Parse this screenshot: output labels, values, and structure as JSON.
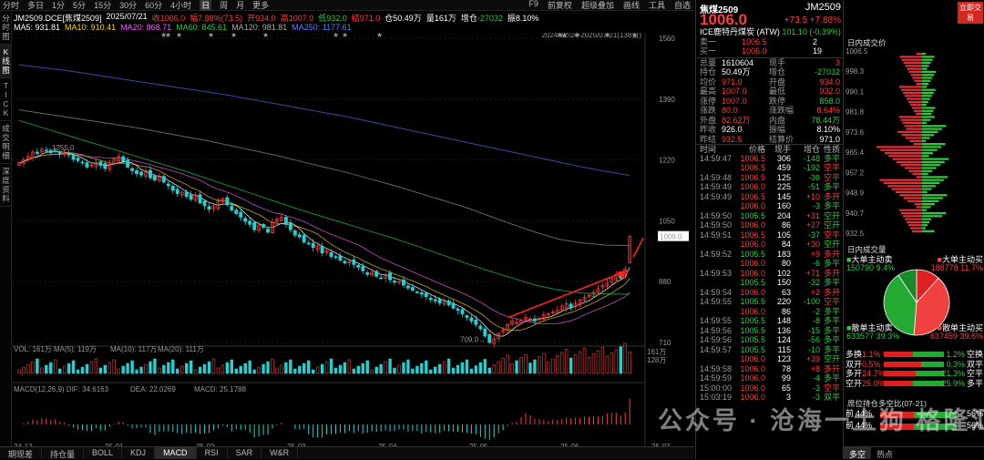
{
  "topbar": {
    "items": [
      "分时",
      "多日",
      "1分",
      "5分",
      "15分",
      "30分",
      "60分",
      "4小时",
      "日",
      "周",
      "月",
      "更多"
    ],
    "selected": "日",
    "right": [
      "F9",
      "前复权",
      "超级叠加",
      "画线",
      "工具",
      "自选"
    ]
  },
  "leftrail": [
    "分时图",
    "K线图",
    "TICK",
    "成交明细",
    "深度资料"
  ],
  "info": {
    "symbol": "JM2509.DCE[焦煤2509]",
    "date": "2025/07/21",
    "close": "收1006.0",
    "change": "幅7.88%(73.5)",
    "open": "开934.0",
    "high": "高1007.0",
    "low": "低932.0",
    "settle": "结971.0",
    "oi": "仓50.49万",
    "vol": "量161万",
    "ci": "-27032",
    "amp": "振8.10%"
  },
  "ma": [
    {
      "label": "MA5",
      "value": "931.81",
      "color": "#ffffff"
    },
    {
      "label": "MA10",
      "value": "910.41",
      "color": "#ffd700"
    },
    {
      "label": "MA20",
      "value": "868.71",
      "color": "#ff55ff"
    },
    {
      "label": "MA60",
      "value": "845.61",
      "color": "#2ecc40"
    },
    {
      "label": "MA120",
      "value": "981.81",
      "color": "#aaaaaa"
    },
    {
      "label": "MA250",
      "value": "1177.61",
      "color": "#5f7fff"
    }
  ],
  "chart_data": {
    "type": "candlestick",
    "date_range": "2024/12/24-2025/07/21(138日)",
    "y_ticks": [
      "1560",
      "1390",
      "1220",
      "1050",
      "880",
      "710"
    ],
    "x_ticks": [
      "24-12",
      "25-01",
      "25-02",
      "25-03",
      "25-04",
      "25-05",
      "25-06",
      "25-07"
    ],
    "annotations": {
      "high": "1255.0",
      "low": "709.0",
      "last": "1006.0"
    },
    "closes": [
      1212,
      1220,
      1230,
      1242,
      1238,
      1250,
      1246,
      1240,
      1244,
      1236,
      1242,
      1234,
      1222,
      1218,
      1212,
      1200,
      1206,
      1214,
      1205,
      1196,
      1208,
      1222,
      1230,
      1216,
      1200,
      1190,
      1182,
      1178,
      1190,
      1170,
      1164,
      1172,
      1158,
      1148,
      1135,
      1126,
      1130,
      1118,
      1110,
      1122,
      1100,
      1092,
      1082,
      1090,
      1105,
      1112,
      1095,
      1080,
      1070,
      1060,
      1048,
      1040,
      1025,
      1038,
      1032,
      1018,
      1045,
      1055,
      1060,
      1040,
      1025,
      1010,
      1005,
      990,
      985,
      975,
      980,
      960,
      965,
      950,
      948,
      940,
      932,
      936,
      928,
      920,
      910,
      900,
      906,
      895,
      890,
      900,
      885,
      878,
      880,
      870,
      862,
      856,
      850,
      845,
      838,
      830,
      826,
      820,
      825,
      815,
      806,
      800,
      790,
      780,
      770,
      760,
      748,
      728,
      710,
      720,
      735,
      745,
      760,
      770,
      766,
      772,
      780,
      776,
      770,
      778,
      788,
      790,
      795,
      800,
      812,
      818,
      808,
      820,
      828,
      836,
      842,
      850,
      860,
      870,
      876,
      890,
      900,
      890,
      915,
      1006
    ],
    "ma250": [
      1486,
      1478,
      1470,
      1460,
      1450,
      1440,
      1430,
      1420,
      1410,
      1400,
      1388,
      1376,
      1364,
      1352,
      1340,
      1326,
      1312,
      1298,
      1284,
      1270,
      1256,
      1242,
      1228,
      1214,
      1200,
      1188,
      1177
    ],
    "ma120": [
      1360,
      1350,
      1340,
      1330,
      1320,
      1310,
      1298,
      1286,
      1274,
      1260,
      1246,
      1232,
      1216,
      1200,
      1184,
      1166,
      1148,
      1128,
      1108,
      1088,
      1064,
      1040,
      1018,
      998,
      988,
      982,
      981
    ],
    "ma60": [
      1330,
      1310,
      1290,
      1270,
      1250,
      1230,
      1210,
      1190,
      1168,
      1146,
      1124,
      1102,
      1080,
      1060,
      1040,
      1020,
      1000,
      978,
      955,
      932,
      910,
      890,
      870,
      856,
      848,
      846,
      845
    ],
    "volume": {
      "label": "VOL: 161万",
      "ma5": "MA(5): 119万",
      "ma10": "MA(10): 117万",
      "ma20": "MA(20): 111万",
      "max": "161万",
      "ref": "128万"
    },
    "macd": {
      "label": "MACD(12,26,9)",
      "dif": "DIF: 34.6163",
      "dea": "DEA: 22.0269",
      "macd": "MACD: 25.1788"
    }
  },
  "bottombar": [
    "期现差",
    "持仓量",
    "BOLL",
    "KDJ",
    "MACD",
    "RSI",
    "SAR",
    "W&R"
  ],
  "quote": {
    "name": "焦煤2509",
    "code": "JM2509",
    "badge": "立即交易",
    "price": "1006.0",
    "chg": "+73.5",
    "pct": "+7.88%",
    "related": "ICE鹿特丹煤炭 (ATW)",
    "related_val": "101.10",
    "related_pct": "(-0.39%)",
    "asks": [
      [
        "卖一",
        "1006.5",
        "2"
      ],
      [
        "买一",
        "1006.0",
        "19"
      ]
    ],
    "stats": [
      [
        "总量",
        "1610604",
        "现手",
        "3"
      ],
      [
        "持仓",
        "50.49万",
        "增仓",
        "-27032"
      ],
      [
        "均价",
        "971.0",
        "开盘",
        "934.0"
      ],
      [
        "最高",
        "1007.0",
        "最低",
        "932.0"
      ],
      [
        "涨停",
        "1007.0",
        "跌停",
        "858.0"
      ],
      [
        "涨跌",
        "80.0",
        "涨跌幅",
        "8.64%"
      ],
      [
        "外盘",
        "82.62万",
        "内盘",
        "78.44万"
      ],
      [
        "昨收",
        "926.0",
        "振幅",
        "8.10%"
      ],
      [
        "昨结",
        "932.5",
        "结算价",
        "971.0"
      ]
    ],
    "ticks_header": [
      "时间",
      "价格",
      "现手",
      "增仓",
      "性质"
    ],
    "ticks": [
      [
        "14:59:47",
        "1006.5",
        "306",
        "-148",
        "多平"
      ],
      [
        "",
        "1006.5",
        "459",
        "-192",
        "空平"
      ],
      [
        "14:59:48",
        "1006.5",
        "125",
        "-36",
        "空平"
      ],
      [
        "14:59:49",
        "1006.0",
        "225",
        "-51",
        "多平"
      ],
      [
        "14:59:49",
        "1006.5",
        "145",
        "+10",
        "多开"
      ],
      [
        "",
        "1006.0",
        "160",
        "-3",
        "多平"
      ],
      [
        "14:59:50",
        "1005.5",
        "204",
        "+31",
        "空开"
      ],
      [
        "14:59:50",
        "1006.0",
        "86",
        "+27",
        "空开"
      ],
      [
        "14:59:51",
        "1006.5",
        "105",
        "-37",
        "空平"
      ],
      [
        "",
        "1006.0",
        "84",
        "+30",
        "空开"
      ],
      [
        "14:59:52",
        "1005.5",
        "183",
        "+9",
        "多开"
      ],
      [
        "",
        "1006.0",
        "80",
        "-6",
        "多平"
      ],
      [
        "14:59:53",
        "1006.0",
        "102",
        "+71",
        "多开"
      ],
      [
        "",
        "1005.5",
        "150",
        "-32",
        "多平"
      ],
      [
        "14:59:54",
        "1006.0",
        "63",
        "+2",
        "多开"
      ],
      [
        "14:59:55",
        "1005.5",
        "220",
        "-100",
        "空平"
      ],
      [
        "",
        "1006.0",
        "86",
        "-2",
        "多平"
      ],
      [
        "14:59:55",
        "1005.5",
        "148",
        "-8",
        "多平"
      ],
      [
        "14:59:56",
        "1005.5",
        "136",
        "-15",
        "多平"
      ],
      [
        "14:59:56",
        "1005.5",
        "124",
        "-56",
        "多平"
      ],
      [
        "14:59:57",
        "1005.5",
        "115",
        "-10",
        "多平"
      ],
      [
        "",
        "1006.0",
        "123",
        "+39",
        "空开"
      ],
      [
        "14:59:58",
        "1006.0",
        "78",
        "+8",
        "多开"
      ],
      [
        "14:59:59",
        "1006.0",
        "99",
        "-4",
        "多平"
      ],
      [
        "15:00:00",
        "1006.0",
        "65",
        "-3",
        "空平"
      ],
      [
        "15:03:19",
        "1006.0",
        "3",
        "-3",
        "双平"
      ]
    ]
  },
  "farpanel": {
    "title1": "日内成交价",
    "price_ticks": [
      "1006.5",
      "998.3",
      "990.1",
      "981.8",
      "973.6",
      "965.4",
      "957.2",
      "948.9",
      "940.7",
      "932.5"
    ],
    "title2": "日内成交量",
    "big_sell": "大单主动卖",
    "big_sell_val": "150790",
    "big_sell_pct": "9.4%",
    "big_buy": "大单主动买",
    "big_buy_val": "188778",
    "big_buy_pct": "11.7%",
    "small_sell": "散单主动卖",
    "small_sell_val": "633577",
    "small_sell_pct": "39.3%",
    "small_buy": "散单主动买",
    "small_buy_val": "637459",
    "small_buy_pct": "39.6%",
    "oi_rows": [
      [
        "多换",
        "1.1%",
        "1.2%",
        "空换"
      ],
      [
        "双开",
        "0.5%",
        "0.3%",
        "双平"
      ],
      [
        "多开",
        "24.7%",
        "21.3%",
        "空平"
      ],
      [
        "空开",
        "25.0%",
        "25.9%",
        "多平"
      ]
    ],
    "title3": "席位持仓多空比(07-21)",
    "seat_rows": [
      [
        "前",
        "44%",
        "56%"
      ],
      [
        "前",
        "44%",
        "56%"
      ]
    ],
    "tabs": [
      "多空",
      "热点"
    ]
  },
  "watermark": "公众号 · 沧海一土狗 格隆汇"
}
